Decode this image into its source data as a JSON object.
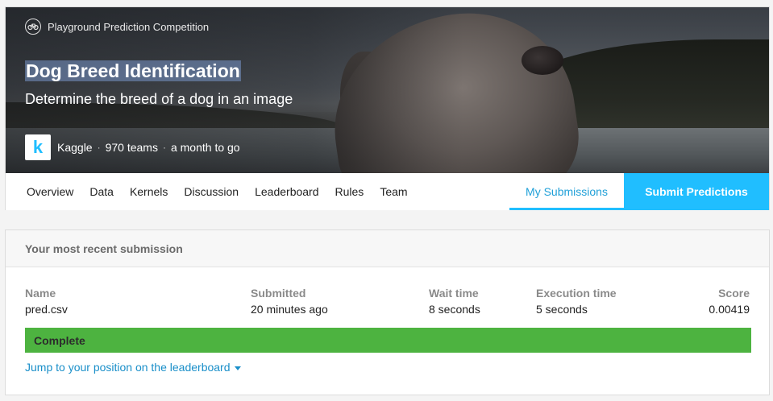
{
  "competition": {
    "type_label": "Playground Prediction Competition",
    "title": "Dog Breed Identification",
    "subtitle": "Determine the breed of a dog in an image",
    "host": "Kaggle",
    "host_logo_letter": "k",
    "teams": "970 teams",
    "time_left": "a month to go",
    "accent_color": "#20beff"
  },
  "nav": {
    "tabs": [
      {
        "label": "Overview"
      },
      {
        "label": "Data"
      },
      {
        "label": "Kernels"
      },
      {
        "label": "Discussion"
      },
      {
        "label": "Leaderboard"
      },
      {
        "label": "Rules"
      },
      {
        "label": "Team"
      }
    ],
    "my_submissions": "My Submissions",
    "submit_button": "Submit Predictions"
  },
  "submission": {
    "header": "Your most recent submission",
    "columns": {
      "name": {
        "label": "Name",
        "value": "pred.csv"
      },
      "submitted": {
        "label": "Submitted",
        "value": "20 minutes ago"
      },
      "wait": {
        "label": "Wait time",
        "value": "8 seconds"
      },
      "execution": {
        "label": "Execution time",
        "value": "5 seconds"
      },
      "score": {
        "label": "Score",
        "value": "0.00419"
      }
    },
    "status": "Complete",
    "status_color": "#4db340",
    "jump_link": "Jump to your position on the leaderboard"
  }
}
